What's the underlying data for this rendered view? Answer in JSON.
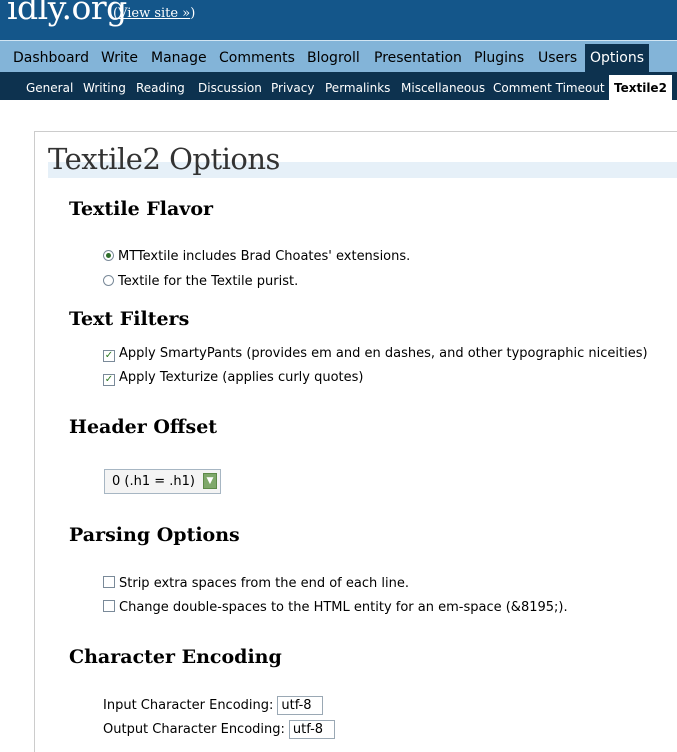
{
  "header": {
    "site_title": "idly.org",
    "view_site_open": "(",
    "view_site": "View site »",
    "view_site_close": ")"
  },
  "admin_menu": {
    "items": [
      "Dashboard",
      "Write",
      "Manage",
      "Comments",
      "Blogroll",
      "Presentation",
      "Plugins",
      "Users",
      "Options"
    ],
    "active": "Options"
  },
  "sub_menu": {
    "items": [
      "General",
      "Writing",
      "Reading",
      "Discussion",
      "Privacy",
      "Permalinks",
      "Miscellaneous",
      "Comment Timeout",
      "Textile2"
    ],
    "active": "Textile2"
  },
  "page": {
    "title": "Textile2 Options"
  },
  "textile_flavor": {
    "heading": "Textile Flavor",
    "options": [
      {
        "label": "MTTextile includes Brad Choates' extensions.",
        "checked": true
      },
      {
        "label": "Textile for the Textile purist.",
        "checked": false
      }
    ]
  },
  "text_filters": {
    "heading": "Text Filters",
    "options": [
      {
        "label": "Apply SmartyPants (provides em and en dashes, and other typographic niceities)",
        "checked": true
      },
      {
        "label": "Apply Texturize (applies curly quotes)",
        "checked": true
      }
    ]
  },
  "header_offset": {
    "heading": "Header Offset",
    "selected": "0 (.h1 = .h1)"
  },
  "parsing_options": {
    "heading": "Parsing Options",
    "options": [
      {
        "label": "Strip extra spaces from the end of each line.",
        "checked": false
      },
      {
        "label": "Change double-spaces to the HTML entity for an em-space (&8195;).",
        "checked": false
      }
    ]
  },
  "character_encoding": {
    "heading": "Character Encoding",
    "input_label": "Input Character Encoding:",
    "input_value": "utf-8",
    "output_label": "Output Character Encoding:",
    "output_value": "utf-8"
  },
  "colors": {
    "header_bg": "#14568a",
    "menu_bg": "#83b4d8",
    "submenu_bg": "#0d324f"
  }
}
